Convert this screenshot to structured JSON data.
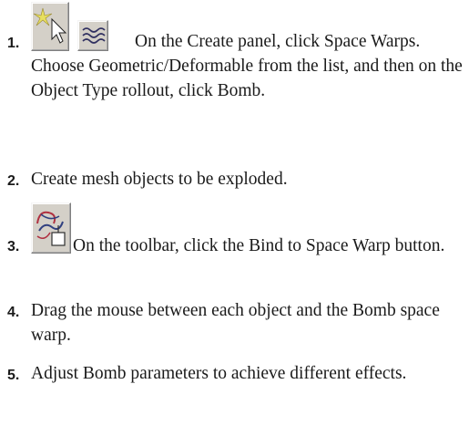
{
  "steps": [
    {
      "number": "1.",
      "icons": [
        "create-object-icon",
        "space-warps-icon"
      ],
      "text": "On the Create panel, click Space Warps. Choose Geometric/Deformable from the list, and then on the Object Type rollout, click Bomb."
    },
    {
      "number": "2.",
      "text": "Create mesh objects to be exploded."
    },
    {
      "number": "3.",
      "icons": [
        "bind-to-space-warp-icon"
      ],
      "text": "On the toolbar, click the Bind to Space Warp button."
    },
    {
      "number": "4.",
      "text": "Drag the mouse between each object and the Bomb space warp."
    },
    {
      "number": "5.",
      "text": "Adjust Bomb parameters to achieve different effects."
    }
  ]
}
